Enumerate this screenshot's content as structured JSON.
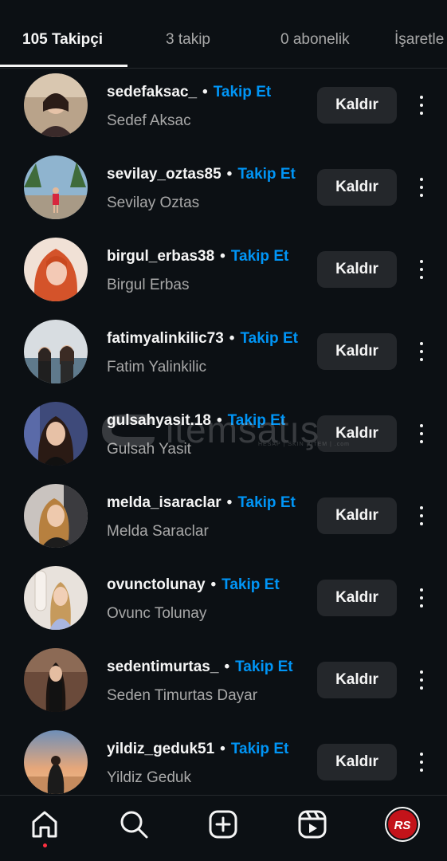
{
  "tabs": [
    {
      "label": "105 Takipçi",
      "active": true
    },
    {
      "label": "3 takip",
      "active": false
    },
    {
      "label": "0 abonelik",
      "active": false
    },
    {
      "label": "İşaretle",
      "active": false
    }
  ],
  "remove_label": "Kaldır",
  "follow_label": "Takip Et",
  "dot": "•",
  "followers": [
    {
      "username": "sedefaksac_",
      "full_name": "Sedef Aksac"
    },
    {
      "username": "sevilay_oztas85",
      "full_name": "Sevilay Oztas"
    },
    {
      "username": "birgul_erbas38",
      "full_name": "Birgul Erbas"
    },
    {
      "username": "fatimyalinkilic73",
      "full_name": "Fatim Yalinkilic"
    },
    {
      "username": "gulsahyasit.18",
      "full_name": "Gulsah Yasit"
    },
    {
      "username": "melda_isaraclar",
      "full_name": "Melda Saraclar"
    },
    {
      "username": "ovunctolunay",
      "full_name": "Ovunc Tolunay"
    },
    {
      "username": "sedentimurtas_",
      "full_name": "Seden Timurtas Dayar"
    },
    {
      "username": "yildiz_geduk51",
      "full_name": "Yildiz Geduk"
    }
  ],
  "watermark": {
    "text": "itemsatış",
    "sub": "HESAP | SKIN | ITEM | .com"
  },
  "bottom_nav": {
    "items": [
      "home-icon",
      "search-icon",
      "create-icon",
      "reels-icon"
    ],
    "profile_initials": "RS"
  },
  "colors": {
    "background": "#0c1014",
    "link_blue": "#0095f6",
    "button_bg": "#24272b",
    "secondary_text": "#a8a8a8",
    "profile_red": "#c3131a"
  }
}
